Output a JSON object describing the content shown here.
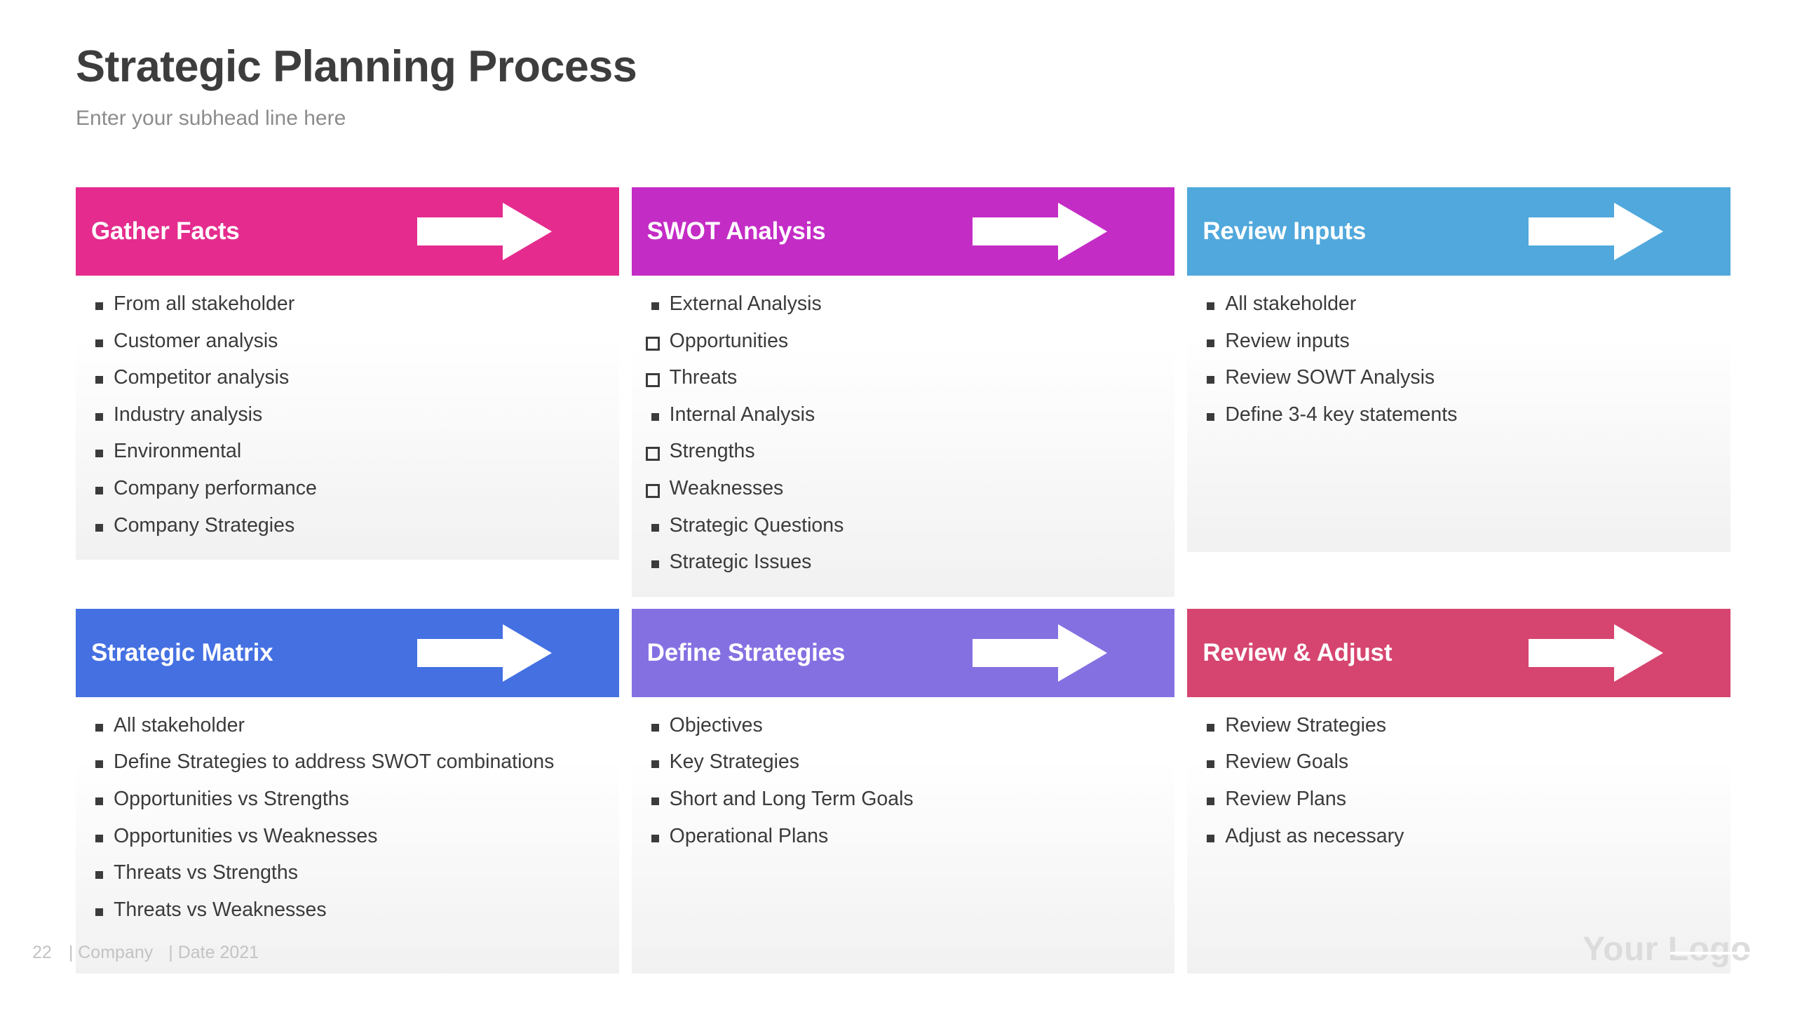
{
  "header": {
    "title": "Strategic Planning Process",
    "subhead": "Enter your subhead line here"
  },
  "colors": {
    "title_text": "#3d3d3d",
    "subhead_text": "#8c8c8c",
    "body_text": "#3b3b3b",
    "footer_text": "#c3c3c3",
    "logo_text": "#dcdcdc",
    "card_body_bg_top": "#ffffff",
    "card_body_bg_bottom": "#f1f1f1",
    "gather_facts": "#E52C8E",
    "swot_analysis": "#C42CC6",
    "review_inputs": "#50A8DC",
    "strategic_matrix": "#4470E2",
    "define_strategies": "#8570E2",
    "review_adjust": "#D6456F"
  },
  "rows": [
    {
      "cards": [
        {
          "title": "Gather Facts",
          "color": "#E52C8E",
          "arrow_icon": "right-arrow-icon",
          "items": [
            {
              "text": "From all stakeholder",
              "mark": "square-filled"
            },
            {
              "text": "Customer analysis",
              "mark": "square-filled"
            },
            {
              "text": "Competitor analysis",
              "mark": "square-filled"
            },
            {
              "text": "Industry analysis",
              "mark": "square-filled"
            },
            {
              "text": "Environmental",
              "mark": "square-filled"
            },
            {
              "text": "Company performance",
              "mark": "square-filled"
            },
            {
              "text": "Company Strategies",
              "mark": "square-filled"
            }
          ]
        },
        {
          "title": "SWOT Analysis",
          "color": "#C42CC6",
          "arrow_icon": "right-arrow-icon",
          "items": [
            {
              "text": "External Analysis",
              "mark": "square-filled"
            },
            {
              "text": "Opportunities",
              "mark": "square-hollow"
            },
            {
              "text": "Threats",
              "mark": "square-hollow"
            },
            {
              "text": "Internal Analysis",
              "mark": "square-filled"
            },
            {
              "text": "Strengths",
              "mark": "square-hollow"
            },
            {
              "text": "Weaknesses",
              "mark": "square-hollow"
            },
            {
              "text": "Strategic Questions",
              "mark": "square-filled"
            },
            {
              "text": "Strategic Issues",
              "mark": "square-filled"
            }
          ]
        },
        {
          "title": "Review Inputs",
          "color": "#50A8DC",
          "arrow_icon": "right-arrow-icon",
          "items": [
            {
              "text": "All stakeholder",
              "mark": "square-filled"
            },
            {
              "text": "Review inputs",
              "mark": "square-filled"
            },
            {
              "text": "Review SOWT Analysis",
              "mark": "square-filled"
            },
            {
              "text": "Define 3-4 key statements",
              "mark": "square-filled"
            }
          ]
        }
      ]
    },
    {
      "cards": [
        {
          "title": "Strategic Matrix",
          "color": "#4470E2",
          "arrow_icon": "right-arrow-icon",
          "items": [
            {
              "text": "All stakeholder",
              "mark": "square-filled"
            },
            {
              "text": "Define Strategies to address SWOT combinations",
              "mark": "square-filled"
            },
            {
              "text": "Opportunities vs Strengths",
              "mark": "square-filled"
            },
            {
              "text": "Opportunities vs Weaknesses",
              "mark": "square-filled"
            },
            {
              "text": "Threats vs Strengths",
              "mark": "square-filled"
            },
            {
              "text": "Threats vs Weaknesses",
              "mark": "square-filled"
            }
          ]
        },
        {
          "title": "Define Strategies",
          "color": "#8570E2",
          "arrow_icon": "right-arrow-icon",
          "items": [
            {
              "text": "Objectives",
              "mark": "square-filled"
            },
            {
              "text": "Key Strategies",
              "mark": "square-filled"
            },
            {
              "text": "Short and Long Term Goals",
              "mark": "square-filled"
            },
            {
              "text": "Operational Plans",
              "mark": "square-filled"
            }
          ]
        },
        {
          "title": "Review & Adjust",
          "color": "#D6456F",
          "arrow_icon": "right-arrow-icon",
          "items": [
            {
              "text": "Review Strategies",
              "mark": "square-filled"
            },
            {
              "text": "Review Goals",
              "mark": "square-filled"
            },
            {
              "text": "Review Plans",
              "mark": "square-filled"
            },
            {
              "text": "Adjust as necessary",
              "mark": "square-filled"
            }
          ]
        }
      ]
    }
  ],
  "footer": {
    "page_number": "22",
    "company": "| Company",
    "date": "| Date 2021",
    "logo": "Your Logo"
  }
}
